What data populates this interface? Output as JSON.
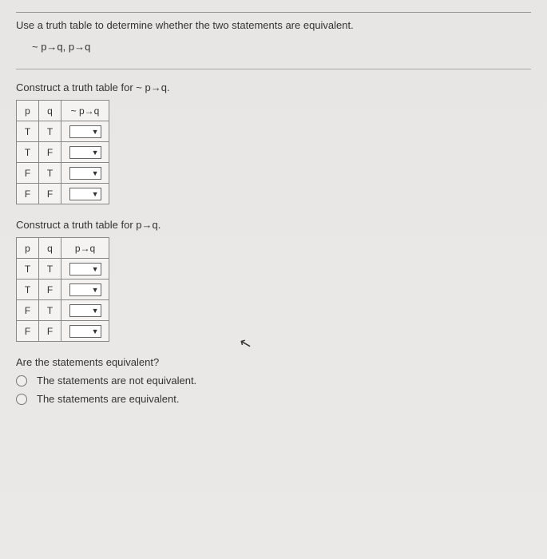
{
  "question": "Use a truth table to determine whether the two statements are equivalent.",
  "expression": "~ p→q, p→q",
  "section1_label": "Construct a truth table for ~ p→q.",
  "section2_label": "Construct a truth table for p→q.",
  "table1": {
    "headers": {
      "col1": "p",
      "col2": "q",
      "col3": "~ p→q"
    },
    "rows": [
      {
        "p": "T",
        "q": "T"
      },
      {
        "p": "T",
        "q": "F"
      },
      {
        "p": "F",
        "q": "T"
      },
      {
        "p": "F",
        "q": "F"
      }
    ]
  },
  "table2": {
    "headers": {
      "col1": "p",
      "col2": "q",
      "col3": "p→q"
    },
    "rows": [
      {
        "p": "T",
        "q": "T"
      },
      {
        "p": "T",
        "q": "F"
      },
      {
        "p": "F",
        "q": "T"
      },
      {
        "p": "F",
        "q": "F"
      }
    ]
  },
  "answer_prompt": "Are the statements equivalent?",
  "options": {
    "a": "The statements are not equivalent.",
    "b": "The statements are equivalent."
  },
  "dropdown_indicator": "▼"
}
